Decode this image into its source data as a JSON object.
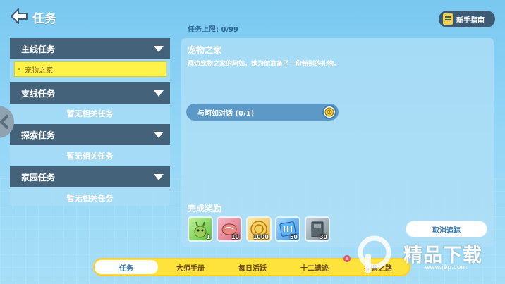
{
  "header": {
    "title": "任务",
    "guide_label": "新手指南"
  },
  "quest_limit": "任务上限: 0/99",
  "categories": [
    {
      "label": "主线任务",
      "empty_text": ""
    },
    {
      "label": "支线任务",
      "empty_text": "暂无相关任务"
    },
    {
      "label": "探索任务",
      "empty_text": "暂无相关任务"
    },
    {
      "label": "家园任务",
      "empty_text": "暂无相关任务"
    }
  ],
  "selected_quest": "宠物之家",
  "detail": {
    "title": "宠物之家",
    "description": "拜访宠物之家的阿如，她为你准备了一份特别的礼物。",
    "objective": "与阿如对话 (0/1)",
    "reward_title": "完成奖励",
    "rewards": [
      {
        "icon": "pet-creature-icon",
        "count": "1",
        "color": "#7ccf5a"
      },
      {
        "icon": "meat-icon",
        "count": "10",
        "color": "#e58a8a"
      },
      {
        "icon": "coin-icon",
        "count": "1000",
        "color": "#f4c14a"
      },
      {
        "icon": "blue-ticket-icon",
        "count": "50",
        "color": "#4f9ee6"
      },
      {
        "icon": "book-icon",
        "count": "30",
        "color": "#8a9aa4"
      }
    ],
    "cancel_label": "取消追踪"
  },
  "tabs": [
    {
      "label": "任务",
      "active": true
    },
    {
      "label": "大师手册",
      "active": false
    },
    {
      "label": "每日活跃",
      "active": false
    },
    {
      "label": "十二遗迹",
      "active": false,
      "badge": "!"
    },
    {
      "label": "探索之路",
      "active": false
    }
  ],
  "watermark": {
    "text": "精品下载",
    "url": "www.j9p.com"
  }
}
